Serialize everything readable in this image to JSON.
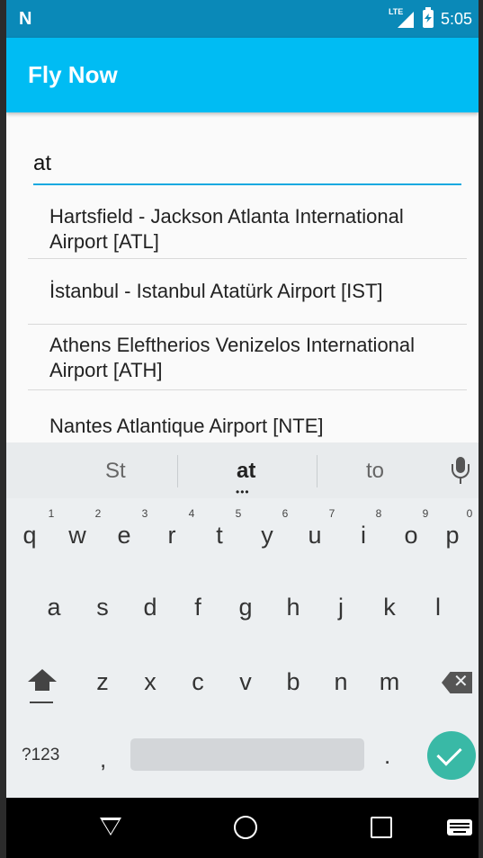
{
  "status_bar": {
    "network": "LTE",
    "time": "5:05"
  },
  "app_bar": {
    "title": "Fly Now"
  },
  "search": {
    "value": "at"
  },
  "suggestions": [
    {
      "text": "Hartsfield - Jackson Atlanta International Airport [ATL]"
    },
    {
      "text": "İstanbul - Istanbul Atatürk Airport [IST]"
    },
    {
      "text": "Athens Eleftherios Venizelos International Airport [ATH]"
    },
    {
      "text": "Nantes Atlantique Airport [NTE]"
    }
  ],
  "keyboard": {
    "suggestions": [
      "St",
      "at",
      "to"
    ],
    "row1": [
      "q",
      "w",
      "e",
      "r",
      "t",
      "y",
      "u",
      "i",
      "o",
      "p"
    ],
    "row1_hints": [
      "1",
      "2",
      "3",
      "4",
      "5",
      "6",
      "7",
      "8",
      "9",
      "0"
    ],
    "row2": [
      "a",
      "s",
      "d",
      "f",
      "g",
      "h",
      "j",
      "k",
      "l"
    ],
    "row3": [
      "z",
      "x",
      "c",
      "v",
      "b",
      "n",
      "m"
    ],
    "symbols_label": "?123",
    "comma": ",",
    "period": "."
  },
  "colors": {
    "status_bar": "#0a89b8",
    "app_bar": "#00bcf3",
    "accent": "#17a9e0",
    "enter_key": "#39b9a6"
  },
  "icons": {
    "status_logo": "n-logo-icon",
    "signal": "lte-signal-icon",
    "battery": "battery-charging-icon",
    "mic": "mic-icon",
    "shift": "shift-icon",
    "backspace": "backspace-icon",
    "enter": "check-icon",
    "nav": [
      "back-icon",
      "home-icon",
      "recents-icon",
      "keyboard-icon"
    ]
  }
}
